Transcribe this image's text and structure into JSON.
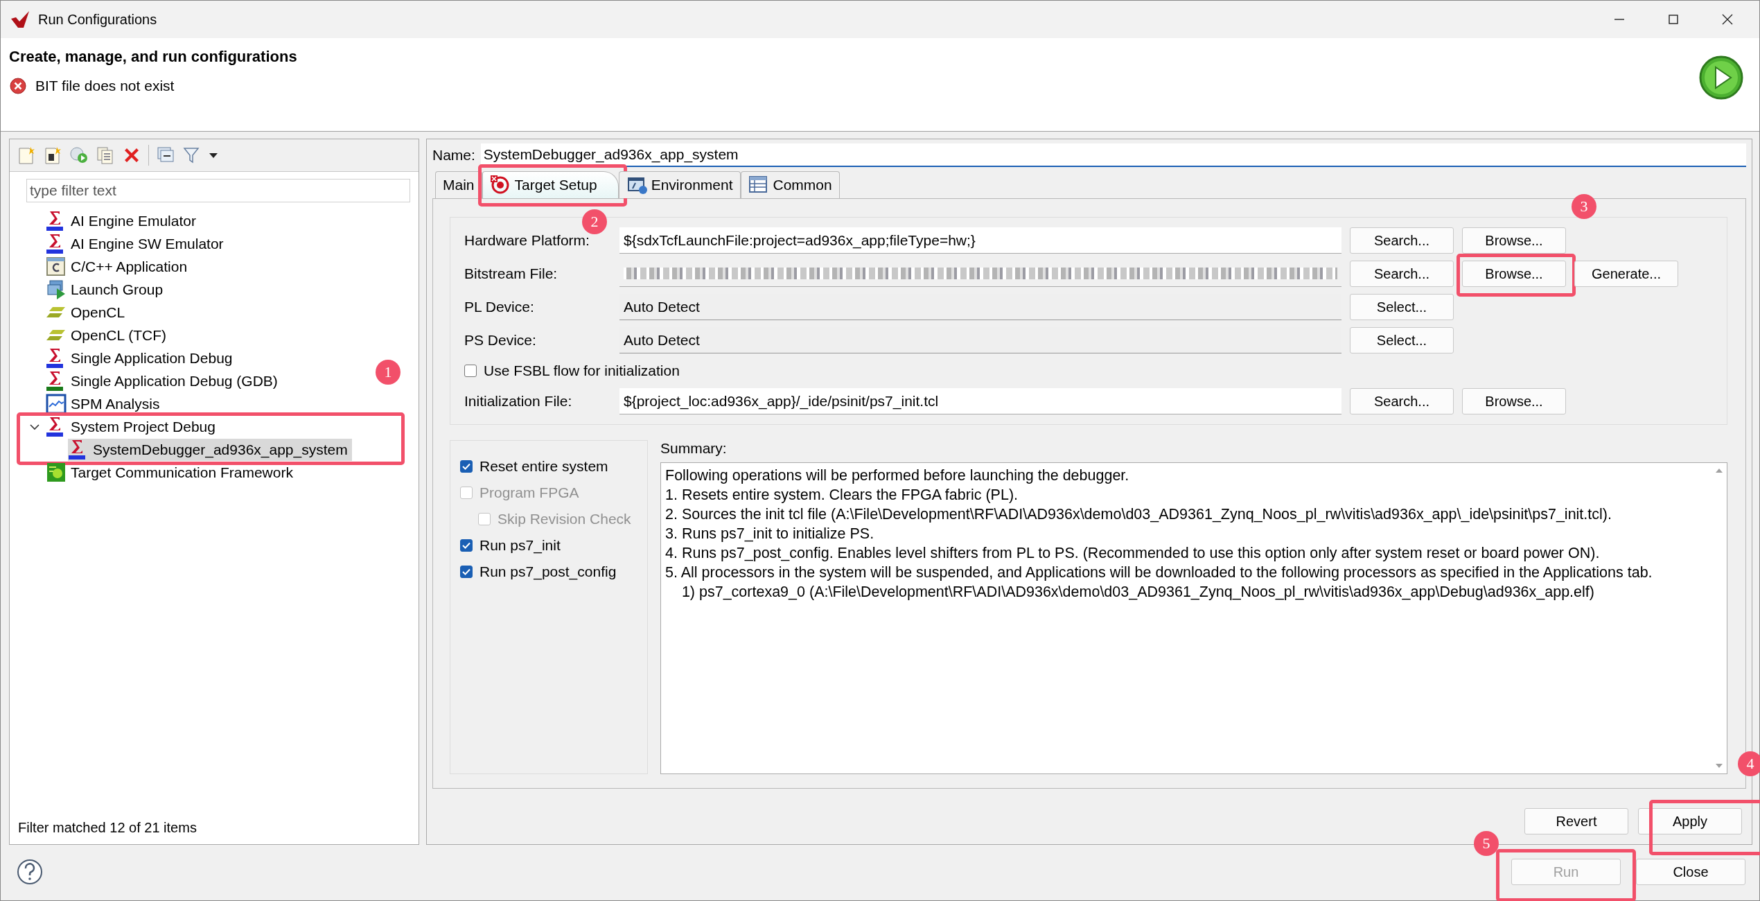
{
  "window": {
    "title": "Run Configurations"
  },
  "header": {
    "title": "Create, manage, and run configurations",
    "message": {
      "kind": "error",
      "text": "BIT file does not exist"
    }
  },
  "tree": {
    "filter_placeholder": "type filter text",
    "items": [
      {
        "label": "AI Engine Emulator",
        "kind": "tcf",
        "selected": false
      },
      {
        "label": "AI Engine SW Emulator",
        "kind": "tcf",
        "selected": false
      },
      {
        "label": "C/C++ Application",
        "kind": "c-app",
        "selected": false
      },
      {
        "label": "Launch Group",
        "kind": "launch",
        "selected": false
      },
      {
        "label": "OpenCL",
        "kind": "opencl",
        "selected": false
      },
      {
        "label": "OpenCL (TCF)",
        "kind": "opencl",
        "selected": false
      },
      {
        "label": "Single Application Debug",
        "kind": "tcf",
        "selected": false
      },
      {
        "label": "Single Application Debug (GDB)",
        "kind": "gdb",
        "selected": false
      },
      {
        "label": "SPM Analysis",
        "kind": "spm",
        "selected": false
      },
      {
        "label": "System Project Debug",
        "kind": "tcf",
        "selected": false,
        "expanded": true,
        "highlighted": true,
        "callout": "1",
        "children": [
          {
            "label": "SystemDebugger_ad936x_app_system",
            "kind": "tcf",
            "selected": true
          }
        ]
      },
      {
        "label": "Target Communication Framework",
        "kind": "framework",
        "selected": false
      }
    ],
    "status": "Filter matched 12 of 21 items"
  },
  "name_field": {
    "label": "Name:",
    "value": "SystemDebugger_ad936x_app_system"
  },
  "tabs": [
    {
      "label": "Main",
      "kind": "plain",
      "selected": false
    },
    {
      "label": "Target Setup",
      "kind": "target",
      "selected": true,
      "highlighted": true,
      "callout": "2"
    },
    {
      "label": "Environment",
      "kind": "environment",
      "selected": false
    },
    {
      "label": "Common",
      "kind": "table",
      "selected": false
    }
  ],
  "form_rows": [
    {
      "kind": "text",
      "label": "Hardware Platform:",
      "value": "${sdxTcfLaunchFile:project=ad936x_app;fileType=hw;}",
      "buttons": [
        {
          "label": "Search..."
        },
        {
          "label": "Browse..."
        }
      ]
    },
    {
      "kind": "redacted",
      "label": "Bitstream File:",
      "buttons": [
        {
          "label": "Search..."
        },
        {
          "label": "Browse...",
          "highlighted": true,
          "callout": "3"
        },
        {
          "label": "Generate..."
        }
      ]
    },
    {
      "kind": "readonly",
      "label": "PL Device:",
      "value": "Auto Detect",
      "buttons": [
        {
          "label": "Select..."
        }
      ]
    },
    {
      "kind": "readonly",
      "label": "PS Device:",
      "value": "Auto Detect",
      "buttons": [
        {
          "label": "Select..."
        }
      ]
    },
    {
      "kind": "checkbox",
      "label": "Use FSBL flow for initialization",
      "checked": false
    },
    {
      "kind": "text",
      "label": "Initialization File:",
      "value": "${project_loc:ad936x_app}/_ide/psinit/ps7_init.tcl",
      "buttons": [
        {
          "label": "Search..."
        },
        {
          "label": "Browse..."
        }
      ]
    }
  ],
  "options": [
    {
      "label": "Reset entire system",
      "checked": true,
      "disabled": false
    },
    {
      "label": "Program FPGA",
      "checked": false,
      "disabled": true,
      "children": [
        {
          "label": "Skip Revision Check",
          "checked": false,
          "disabled": true
        }
      ]
    },
    {
      "label": "Run ps7_init",
      "checked": true,
      "disabled": false
    },
    {
      "label": "Run ps7_post_config",
      "checked": true,
      "disabled": false
    }
  ],
  "summary": {
    "label": "Summary:",
    "lines": [
      "Following operations will be performed before launching the debugger.",
      "1. Resets entire system. Clears the FPGA fabric (PL).",
      "2. Sources the init tcl file (A:\\File\\Development\\RF\\ADI\\AD936x\\demo\\d03_AD9361_Zynq_Noos_pl_rw\\vitis\\ad936x_app\\_ide\\psinit\\ps7_init.tcl).",
      "3. Runs ps7_init to initialize PS.",
      "4. Runs ps7_post_config. Enables level shifters from PL to PS. (Recommended to use this option only after system reset or board power ON).",
      "5. All processors in the system will be suspended, and Applications will be downloaded to the following processors as specified in the Applications tab.",
      "    1) ps7_cortexa9_0 (A:\\File\\Development\\RF\\ADI\\AD936x\\demo\\d03_AD9361_Zynq_Noos_pl_rw\\vitis\\ad936x_app\\Debug\\ad936x_app.elf)"
    ]
  },
  "apply_buttons": [
    {
      "label": "Revert",
      "disabled": false
    },
    {
      "label": "Apply",
      "disabled": false,
      "highlighted": true,
      "callout": "4"
    }
  ],
  "dialog_buttons": [
    {
      "label": "Run",
      "disabled": true,
      "highlighted": true,
      "callout": "5"
    },
    {
      "label": "Close",
      "disabled": false
    }
  ]
}
